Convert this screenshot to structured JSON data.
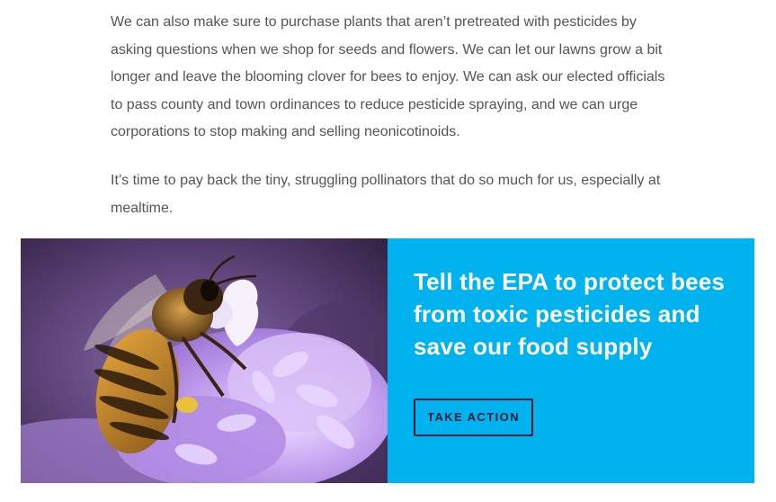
{
  "article": {
    "paragraph_1": "We can also make sure to purchase plants that aren’t pretreated with pesticides by asking questions when we shop for seeds and flowers. We can let our lawns grow a bit longer and leave the blooming clover for bees to enjoy. We can ask our elected officials to pass county and town ordinances to reduce pesticide spraying, and we can urge corporations to stop making and selling neonicotinoids.",
    "paragraph_2": "It’s time to pay back the tiny, struggling pollinators that do so much for us, especially at mealtime."
  },
  "cta": {
    "headline": "Tell the EPA to protect bees from toxic pesticides and save our food supply",
    "button_label": "TAKE ACTION",
    "colors": {
      "panel": "#00b3ee",
      "button_border": "#0e1d3b",
      "headline": "#ffffff"
    },
    "image_icon": "bee-on-flower-photo"
  }
}
